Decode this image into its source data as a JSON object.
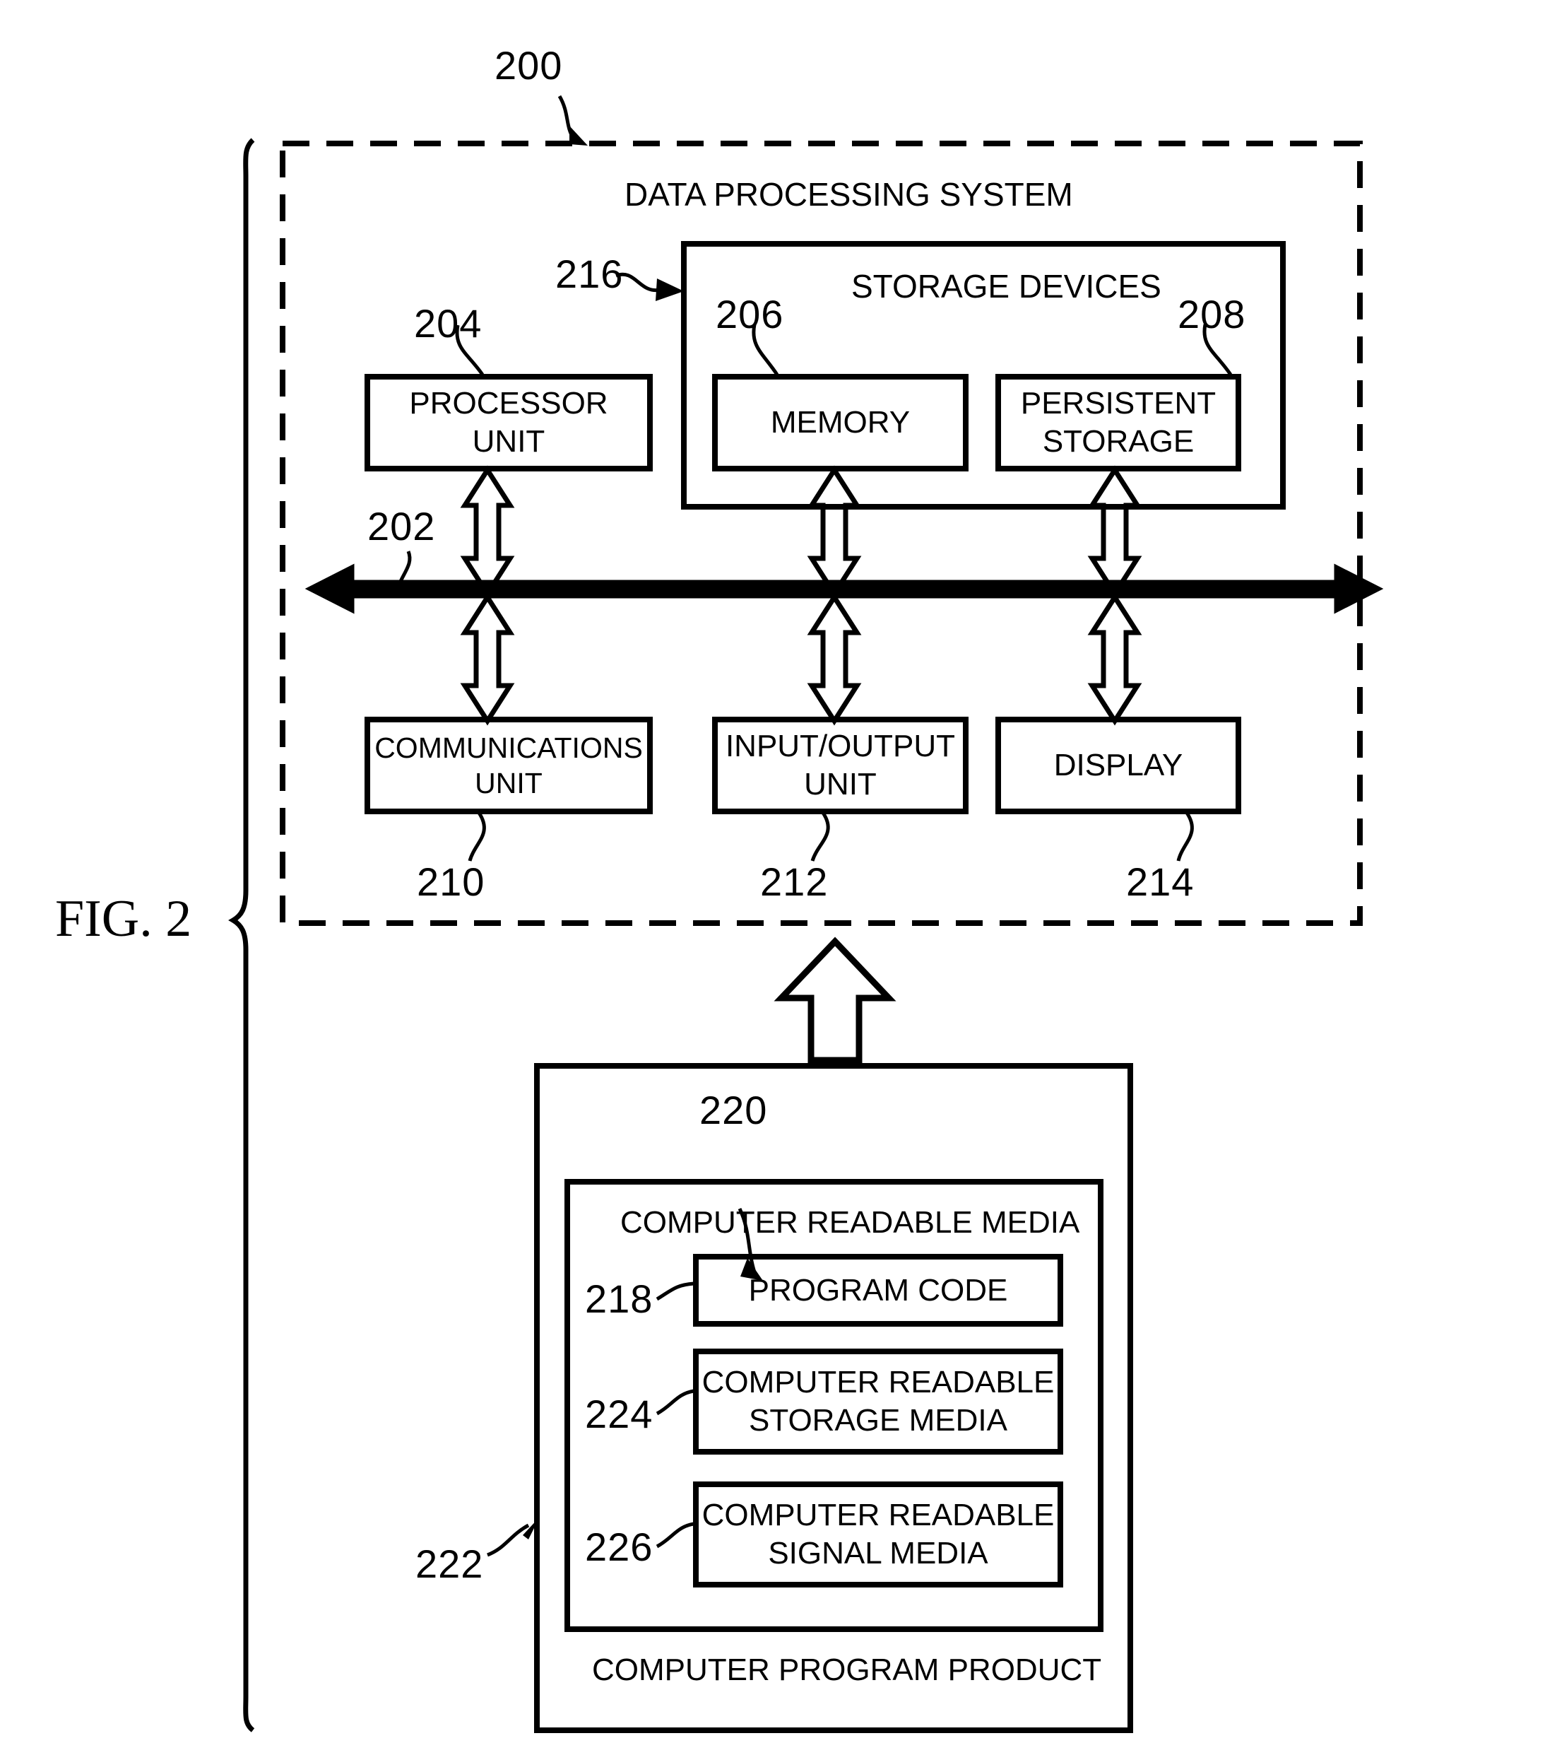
{
  "figure": {
    "caption": "FIG. 2",
    "system_ref": "200",
    "system_title": "DATA PROCESSING SYSTEM"
  },
  "storage_group": {
    "title": "STORAGE DEVICES",
    "ref": "216",
    "items": [
      {
        "label": "MEMORY",
        "ref": "206"
      },
      {
        "label": "PERSISTENT\nSTORAGE",
        "ref": "208"
      }
    ]
  },
  "bus": {
    "ref": "202"
  },
  "top_row": [
    {
      "label": "PROCESSOR\nUNIT",
      "ref": "204"
    }
  ],
  "bottom_row": [
    {
      "label": "COMMUNICATIONS\nUNIT",
      "ref": "210"
    },
    {
      "label": "INPUT/OUTPUT\nUNIT",
      "ref": "212"
    },
    {
      "label": "DISPLAY",
      "ref": "214"
    }
  ],
  "program_product": {
    "title": "COMPUTER PROGRAM PRODUCT",
    "ref": "222",
    "media": {
      "title": "COMPUTER READABLE MEDIA",
      "ref": "220",
      "items": [
        {
          "label": "PROGRAM CODE",
          "ref": "218"
        },
        {
          "label": "COMPUTER READABLE\nSTORAGE MEDIA",
          "ref": "224"
        },
        {
          "label": "COMPUTER READABLE\nSIGNAL MEDIA",
          "ref": "226"
        }
      ]
    }
  },
  "colors": {
    "line": "#000000",
    "background": "#ffffff"
  }
}
